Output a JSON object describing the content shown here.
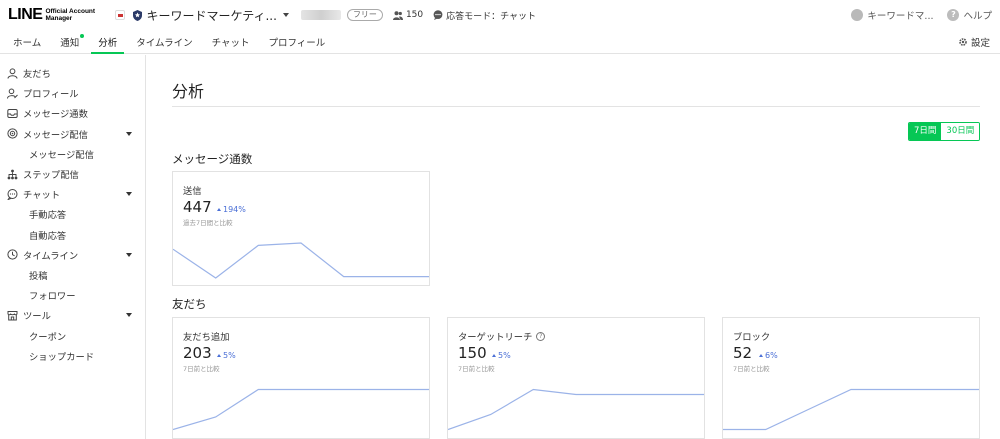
{
  "header": {
    "logo_main": "LINE",
    "logo_sub": "Official Account\nManager",
    "account_name": "キーワードマーケティ...",
    "plan_badge": "フリー",
    "friends_count": "150",
    "response_mode": "応答モード：チャット",
    "user_name": "キーワードマ...",
    "help": "ヘルプ"
  },
  "tabs": [
    {
      "label": "ホーム"
    },
    {
      "label": "通知",
      "badge": true
    },
    {
      "label": "分析",
      "active": true
    },
    {
      "label": "タイムライン"
    },
    {
      "label": "チャット"
    },
    {
      "label": "プロフィール"
    }
  ],
  "settings_label": "設定",
  "sidebar": {
    "items": [
      {
        "label": "友だち",
        "icon": "person-icon"
      },
      {
        "label": "プロフィール",
        "icon": "profile-icon"
      },
      {
        "label": "メッセージ通数",
        "icon": "inbox-icon"
      },
      {
        "label": "メッセージ配信",
        "icon": "broadcast-icon",
        "expandable": true
      },
      {
        "label": "メッセージ配信",
        "sub": true
      },
      {
        "label": "ステップ配信",
        "icon": "step-icon"
      },
      {
        "label": "チャット",
        "icon": "chat-icon",
        "expandable": true
      },
      {
        "label": "手動応答",
        "sub": true
      },
      {
        "label": "自動応答",
        "sub": true
      },
      {
        "label": "タイムライン",
        "icon": "clock-icon",
        "expandable": true
      },
      {
        "label": "投稿",
        "sub": true
      },
      {
        "label": "フォロワー",
        "sub": true
      },
      {
        "label": "ツール",
        "icon": "store-icon",
        "expandable": true
      },
      {
        "label": "クーポン",
        "sub": true
      },
      {
        "label": "ショップカード",
        "sub": true
      }
    ]
  },
  "main": {
    "title": "分析",
    "period": {
      "seven": "7日間",
      "thirty": "30日間",
      "selected": "7日間"
    },
    "sections": {
      "messages": "メッセージ通数",
      "friends": "友だち"
    },
    "cards": [
      {
        "label": "送信",
        "value": "447",
        "delta": "194%",
        "note": "過去7日間と比較",
        "spark": [
          0.62,
          0.02,
          0.7,
          0.75,
          0.05,
          0.05,
          0.05
        ]
      },
      {
        "label": "友だち追加",
        "value": "203",
        "delta": "5%",
        "note": "7日前と比較",
        "spark": [
          0.05,
          0.3,
          0.85,
          0.85,
          0.85,
          0.85,
          0.85
        ]
      },
      {
        "label": "ターゲットリーチ",
        "value": "150",
        "delta": "5%",
        "note": "7日前と比較",
        "help": true,
        "spark": [
          0.05,
          0.35,
          0.85,
          0.75,
          0.75,
          0.75,
          0.75
        ]
      },
      {
        "label": "ブロック",
        "value": "52",
        "delta": "6%",
        "note": "7日前と比較",
        "spark": [
          0.05,
          0.05,
          0.45,
          0.85,
          0.85,
          0.85,
          0.85
        ]
      }
    ]
  },
  "colors": {
    "accent": "#06c755",
    "trend": "#4a6fd6",
    "spark": "#9bb3e8"
  }
}
